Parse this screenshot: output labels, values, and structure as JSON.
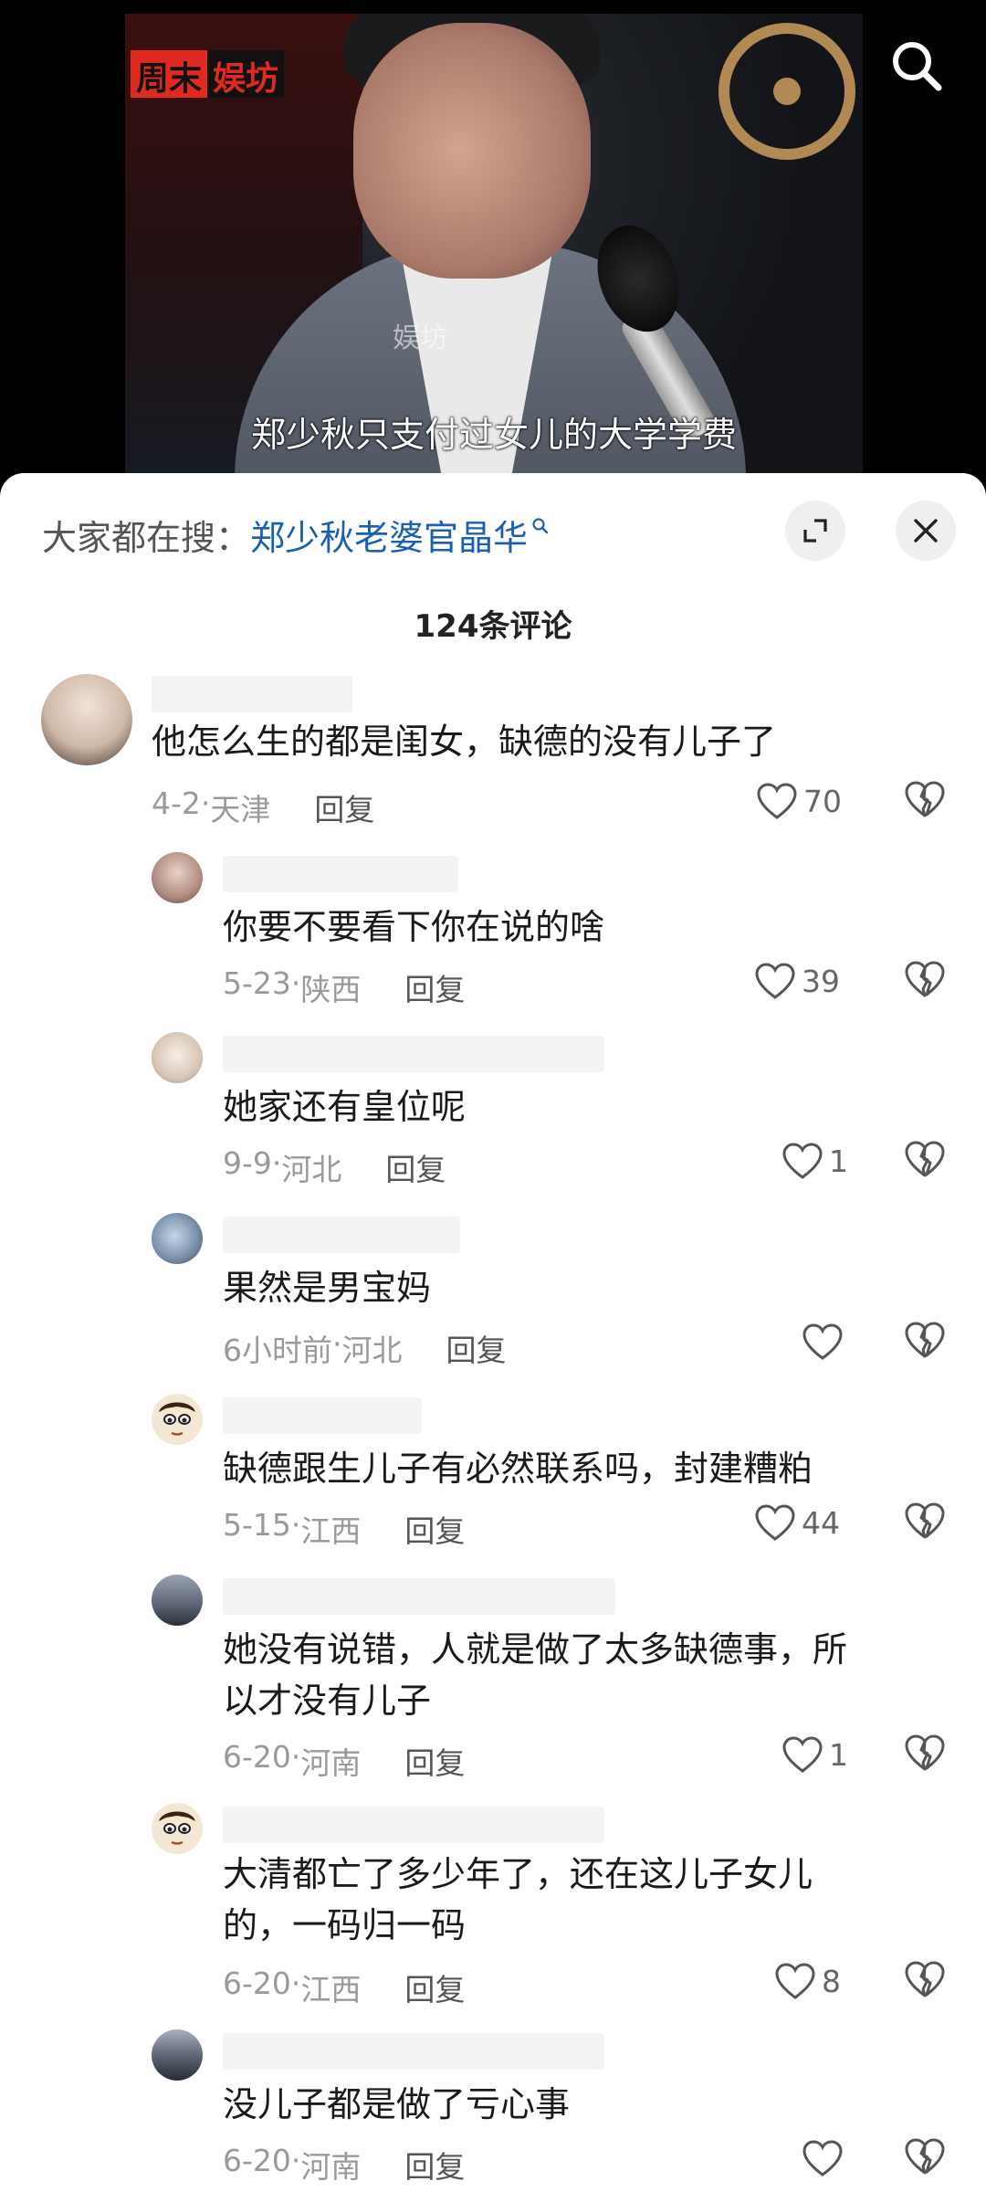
{
  "video": {
    "logo_part1": "周末",
    "logo_part2": "娱坊",
    "watermark": "娱坊",
    "subtitle": "郑少秋只支付过女儿的大学学费"
  },
  "sheet": {
    "search_prefix": "大家都在搜：",
    "search_keyword": "郑少秋老婆官晶华",
    "comment_count": "124条评论"
  },
  "comments": [
    {
      "text": "他怎么生的都是闺女，缺德的没有儿子了",
      "date": "4-2",
      "location": "天津",
      "reply": "回复",
      "likes": "70"
    },
    {
      "text": "你要不要看下你在说的啥",
      "date": "5-23",
      "location": "陕西",
      "reply": "回复",
      "likes": "39"
    },
    {
      "text": "她家还有皇位呢",
      "date": "9-9",
      "location": "河北",
      "reply": "回复",
      "likes": "1"
    },
    {
      "text": "果然是男宝妈",
      "date": "6小时前",
      "location": "河北",
      "reply": "回复",
      "likes": ""
    },
    {
      "text": "缺德跟生儿子有必然联系吗，封建糟粕",
      "date": "5-15",
      "location": "江西",
      "reply": "回复",
      "likes": "44"
    },
    {
      "text_line1": "她没有说错，人就是做了太多缺德事，所",
      "text_line2": "以才没有儿子",
      "date": "6-20",
      "location": "河南",
      "reply": "回复",
      "likes": "1"
    },
    {
      "text_line1": "大清都亡了多少年了，还在这儿子女儿",
      "text_line2": "的，一码归一码",
      "date": "6-20",
      "location": "江西",
      "reply": "回复",
      "likes": "8"
    },
    {
      "text": "没儿子都是做了亏心事",
      "date": "6-20",
      "location": "河南",
      "reply": "回复",
      "likes": ""
    }
  ],
  "icons": {
    "search": "search-icon",
    "expand": "expand-icon",
    "close": "close-icon",
    "like": "heart-icon",
    "dislike": "broken-heart-icon"
  },
  "colors": {
    "keyword_link": "#1b5fb0",
    "logo_red": "#e02a1f"
  }
}
